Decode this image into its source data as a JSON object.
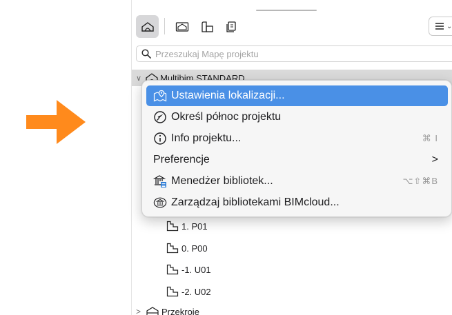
{
  "colors": {
    "arrow": "#ff8a1c",
    "highlight": "#4a90e6"
  },
  "search": {
    "placeholder": "Przeszukaj Mapę projektu"
  },
  "toolbar": {
    "buttons": [
      "project-map-icon",
      "view-map-icon",
      "layout-book-icon",
      "publisher-sets-icon"
    ],
    "menu_icon": "list-icon"
  },
  "tree": {
    "root": {
      "label": "Multibim STANDARD",
      "icon": "house-icon",
      "expanded": true
    },
    "stories": [
      {
        "label": "1. P01",
        "icon": "story-icon"
      },
      {
        "label": "0. P00",
        "icon": "story-icon"
      },
      {
        "label": "-1. U01",
        "icon": "story-icon"
      },
      {
        "label": "-2. U02",
        "icon": "story-icon"
      }
    ],
    "sections": {
      "label": "Przekroje",
      "icon": "section-icon",
      "expanded": false
    }
  },
  "context_menu": {
    "items": [
      {
        "label": "Ustawienia lokalizacji...",
        "icon": "map-location-icon",
        "selected": true,
        "shortcut": ""
      },
      {
        "label": "Określ północ projektu",
        "icon": "compass-icon",
        "selected": false,
        "shortcut": ""
      },
      {
        "label": "Info projektu...",
        "icon": "info-icon",
        "selected": false,
        "shortcut": "⌘ I"
      },
      {
        "label": "Preferencje",
        "icon": "",
        "selected": false,
        "shortcut": "",
        "submenu": ">"
      },
      {
        "label": "Menedżer bibliotek...",
        "icon": "library-manager-icon",
        "selected": false,
        "shortcut": "⌥⇧⌘B"
      },
      {
        "label": "Zarządzaj bibliotekami BIMcloud...",
        "icon": "bimcloud-library-icon",
        "selected": false,
        "shortcut": ""
      }
    ]
  }
}
